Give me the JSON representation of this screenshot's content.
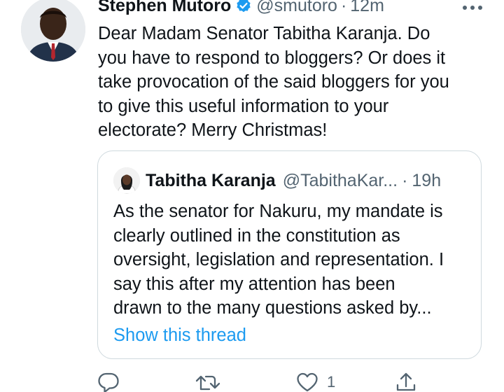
{
  "author": {
    "name": "Stephen Mutoro",
    "handle": "@smutoro",
    "time": "12m",
    "separator": "·"
  },
  "tweet": {
    "text": "Dear Madam Senator Tabitha Karanja. Do\nyou have to respond to bloggers? Or does it\ntake provocation of the said bloggers for you\nto give this useful information to your\nelectorate? Merry Christmas!"
  },
  "quoted": {
    "name": "Tabitha Karanja",
    "handle": "@TabithaKar...",
    "separator": "·",
    "time": "19h",
    "text": "As the senator for Nakuru, my mandate is\nclearly outlined in the constitution as\noversight, legislation and representation. I\nsay this after my attention has been\ndrawn to the many questions asked  by...",
    "show_thread": "Show this thread"
  },
  "actions": {
    "like_count": "1"
  },
  "icons": {
    "verified": "verified-badge-icon",
    "more": "more-options-icon",
    "reply": "reply-icon",
    "retweet": "retweet-icon",
    "like": "heart-icon",
    "share": "share-icon"
  },
  "colors": {
    "accent": "#1d9bf0",
    "text": "#0f1419",
    "secondary": "#536471",
    "border": "#cfd9de"
  }
}
